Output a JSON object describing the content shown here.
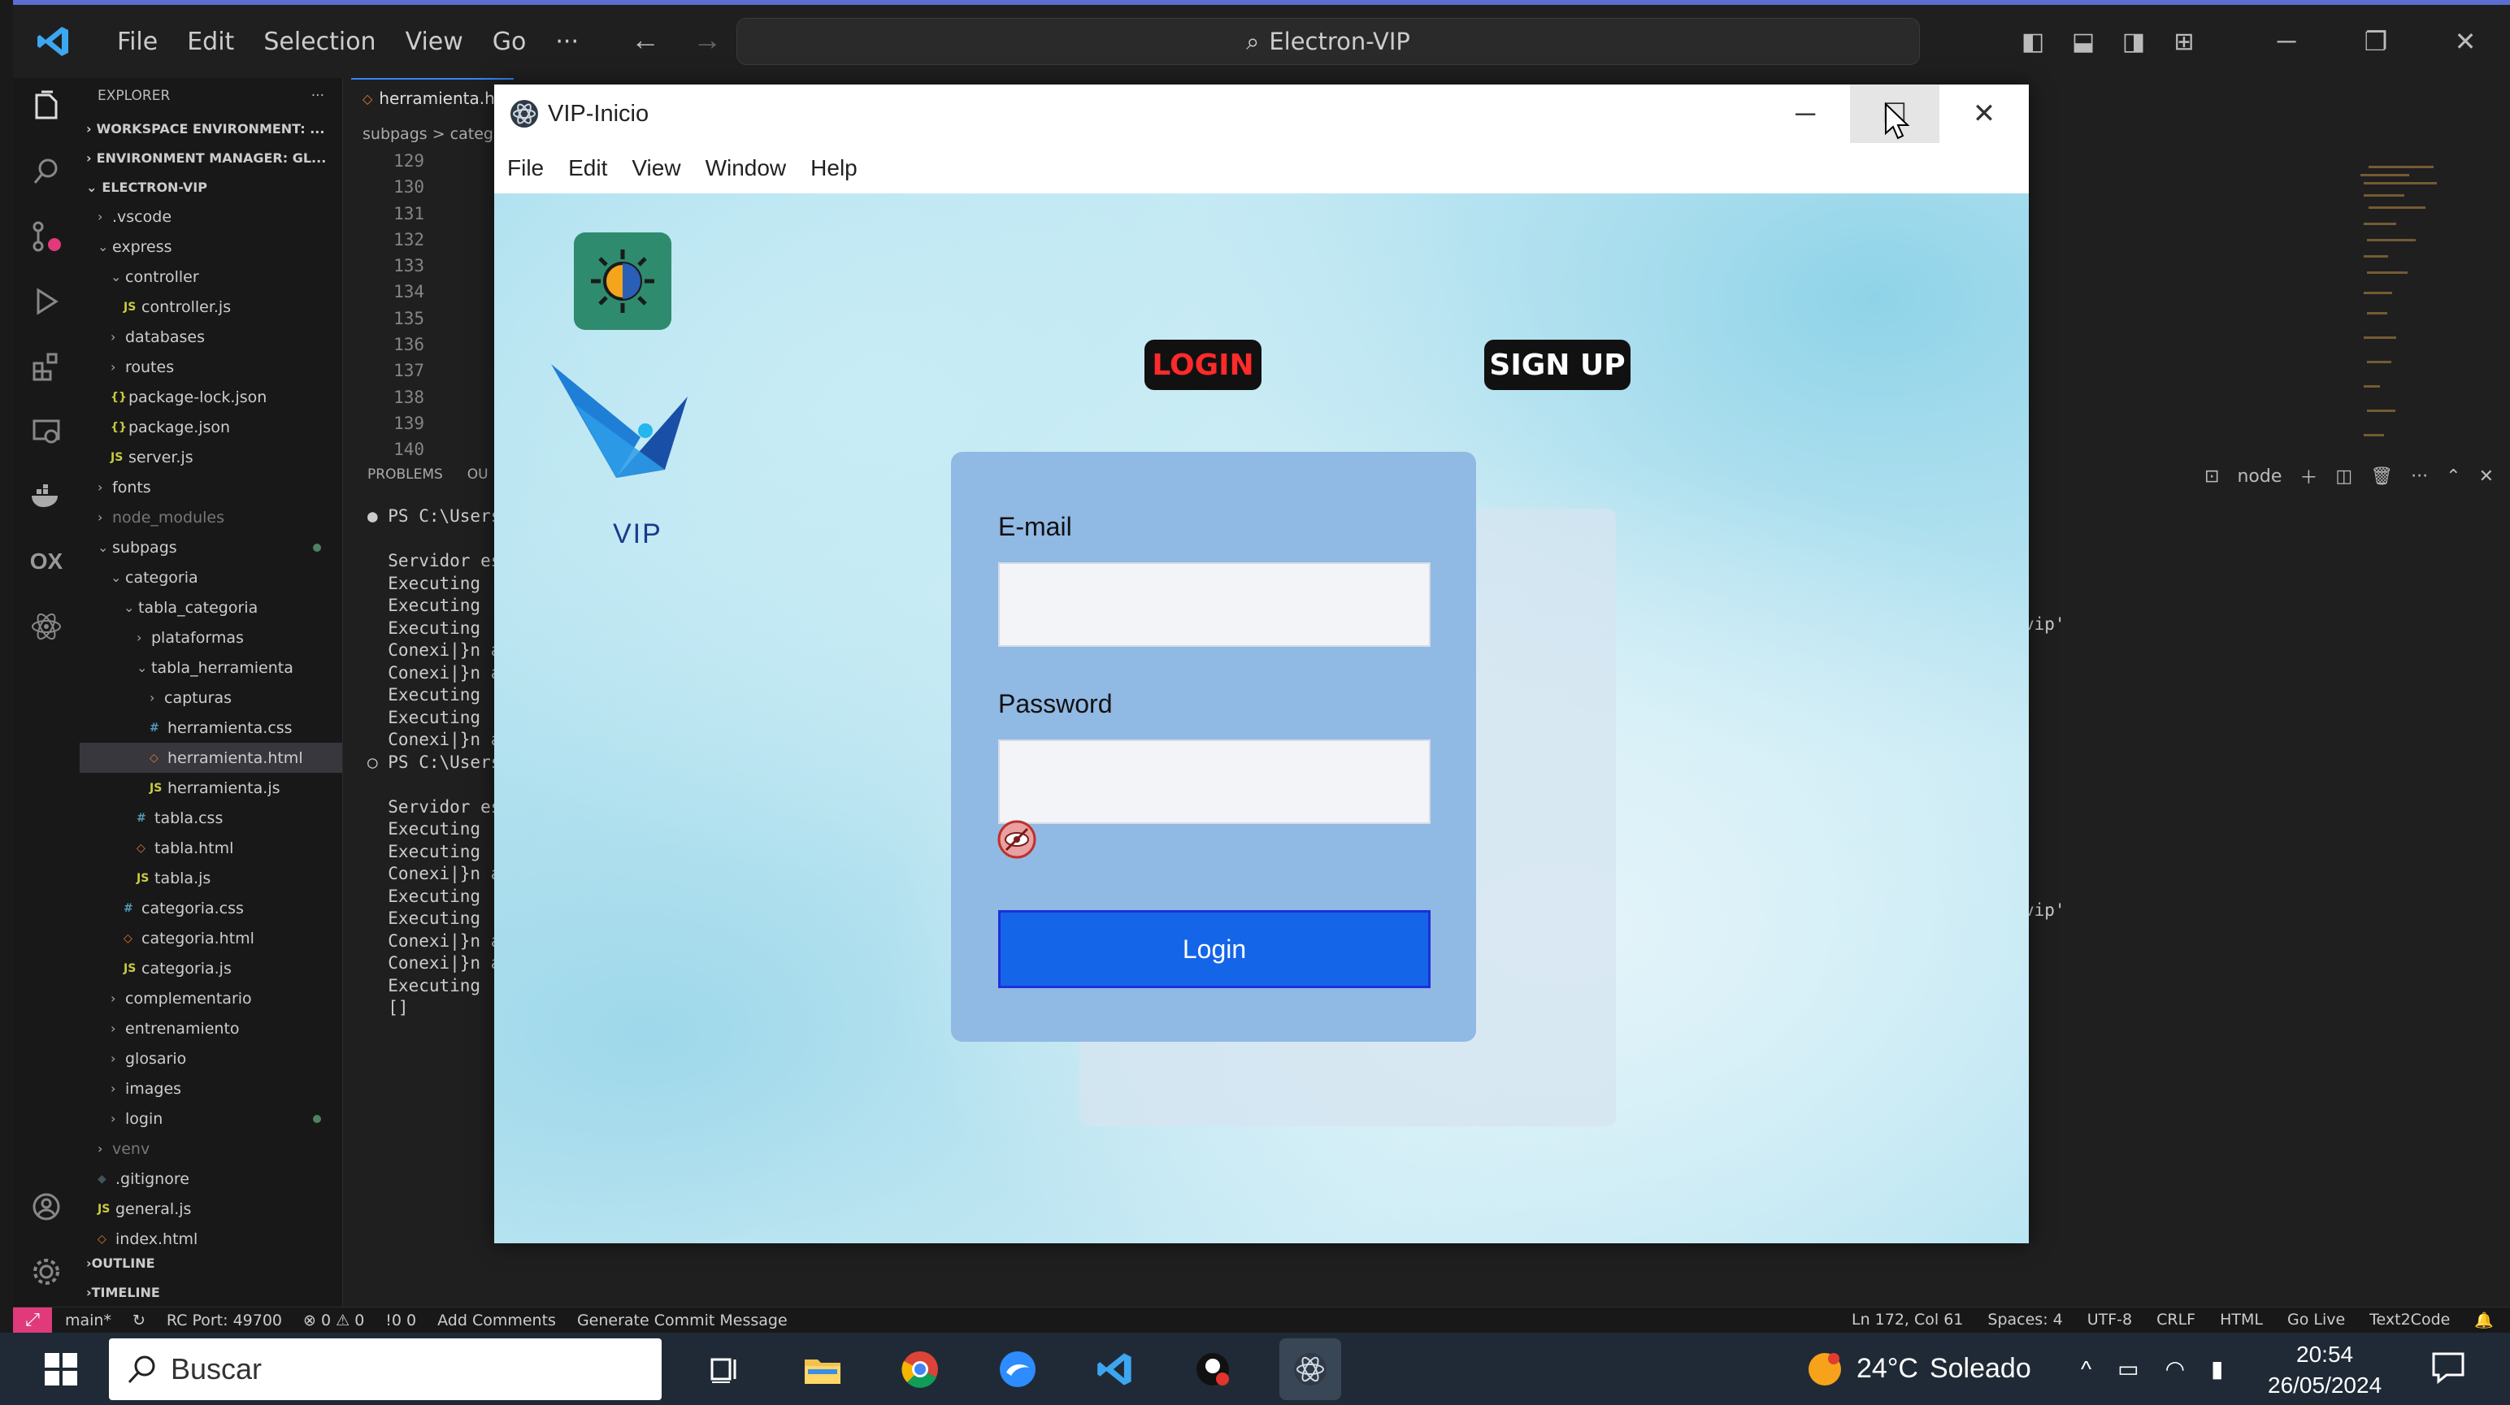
{
  "vscode": {
    "menu": [
      "File",
      "Edit",
      "Selection",
      "View",
      "Go",
      "···"
    ],
    "command_center": "Electron-VIP",
    "explorer": {
      "title": "EXPLORER",
      "sections": [
        "WORKSPACE ENVIRONMENT: ...",
        "ENVIRONMENT MANAGER: GL...",
        "ELECTRON-VIP"
      ],
      "tree": [
        {
          "label": ".vscode",
          "indent": 1,
          "type": "folder",
          "open": false
        },
        {
          "label": "express",
          "indent": 1,
          "type": "folder",
          "open": true
        },
        {
          "label": "controller",
          "indent": 2,
          "type": "folder",
          "open": true
        },
        {
          "label": "controller.js",
          "indent": 3,
          "type": "js"
        },
        {
          "label": "databases",
          "indent": 2,
          "type": "folder",
          "open": false
        },
        {
          "label": "routes",
          "indent": 2,
          "type": "folder",
          "open": false
        },
        {
          "label": "package-lock.json",
          "indent": 2,
          "type": "json"
        },
        {
          "label": "package.json",
          "indent": 2,
          "type": "json"
        },
        {
          "label": "server.js",
          "indent": 2,
          "type": "js"
        },
        {
          "label": "fonts",
          "indent": 1,
          "type": "folder",
          "open": false
        },
        {
          "label": "node_modules",
          "indent": 1,
          "type": "folder",
          "open": false,
          "dim": true
        },
        {
          "label": "subpags",
          "indent": 1,
          "type": "folder",
          "open": true,
          "dot": true
        },
        {
          "label": "categoria",
          "indent": 2,
          "type": "folder",
          "open": true
        },
        {
          "label": "tabla_categoria",
          "indent": 3,
          "type": "folder",
          "open": true
        },
        {
          "label": "plataformas",
          "indent": 4,
          "type": "folder",
          "open": false
        },
        {
          "label": "tabla_herramienta",
          "indent": 4,
          "type": "folder",
          "open": true
        },
        {
          "label": "capturas",
          "indent": 5,
          "type": "folder",
          "open": false
        },
        {
          "label": "herramienta.css",
          "indent": 5,
          "type": "css"
        },
        {
          "label": "herramienta.html",
          "indent": 5,
          "type": "html",
          "selected": true
        },
        {
          "label": "herramienta.js",
          "indent": 5,
          "type": "js"
        },
        {
          "label": "tabla.css",
          "indent": 4,
          "type": "css"
        },
        {
          "label": "tabla.html",
          "indent": 4,
          "type": "html"
        },
        {
          "label": "tabla.js",
          "indent": 4,
          "type": "js"
        },
        {
          "label": "categoria.css",
          "indent": 3,
          "type": "css"
        },
        {
          "label": "categoria.html",
          "indent": 3,
          "type": "html"
        },
        {
          "label": "categoria.js",
          "indent": 3,
          "type": "js"
        },
        {
          "label": "complementario",
          "indent": 2,
          "type": "folder",
          "open": false
        },
        {
          "label": "entrenamiento",
          "indent": 2,
          "type": "folder",
          "open": false
        },
        {
          "label": "glosario",
          "indent": 2,
          "type": "folder",
          "open": false
        },
        {
          "label": "images",
          "indent": 2,
          "type": "folder",
          "open": false
        },
        {
          "label": "login",
          "indent": 2,
          "type": "folder",
          "open": false,
          "dot": true
        },
        {
          "label": "venv",
          "indent": 1,
          "type": "folder",
          "open": false,
          "dim": true
        },
        {
          "label": ".gitignore",
          "indent": 1,
          "type": "git"
        },
        {
          "label": "general.js",
          "indent": 1,
          "type": "js"
        },
        {
          "label": "index.html",
          "indent": 1,
          "type": "html"
        }
      ],
      "bottom_sections": [
        "OUTLINE",
        "TIMELINE"
      ]
    },
    "tab_label": "herramienta.h",
    "breadcrumb": "subpags > categ",
    "line_numbers": [
      "129",
      "130",
      "131",
      "132",
      "133",
      "134",
      "135",
      "136",
      "137",
      "138",
      "139",
      "140"
    ],
    "panel_tabs": [
      "PROBLEMS",
      "OU"
    ],
    "terminal_lines": [
      "● PS C:\\Users\\",
      "",
      "  Servidor esc",
      "  Executing (d",
      "  Executing (d",
      "  Executing (d",
      "  Conexi|}n a",
      "  Conexi|}n a",
      "  Executing (d",
      "  Executing (d",
      "  Conexi|}n a",
      "○ PS C:\\Users\\",
      "",
      "  Servidor esc",
      "  Executing (d",
      "  Executing (d",
      "  Conexi|}n a",
      "  Executing (d",
      "  Executing (d",
      "  Conexi|}n a",
      "  Conexi|}n a",
      "  Executing (d",
      "  []"
    ],
    "terminal_fragments": [
      "vip'",
      "vip'"
    ],
    "terminal_name": "node",
    "status_left": [
      "main*",
      "↻",
      "RC Port: 49700",
      "⊗ 0 ⚠ 0",
      "!0 0",
      "Add Comments",
      "Generate Commit Message"
    ],
    "status_right": [
      "Ln 172, Col 61",
      "Spaces: 4",
      "UTF-8",
      "CRLF",
      "HTML",
      "Go Live",
      "Text2Code"
    ]
  },
  "taskbar": {
    "search_placeholder": "Buscar",
    "weather_temp": "24°C",
    "weather_text": "Soleado",
    "time": "20:54",
    "date": "26/05/2024"
  },
  "app": {
    "title": "VIP-Inicio",
    "menu": [
      "File",
      "Edit",
      "View",
      "Window",
      "Help"
    ],
    "nav_login": "LOGIN",
    "nav_signup": "SIGN UP",
    "logo_text": "VIP",
    "email_label": "E-mail",
    "email_value": "",
    "password_label": "Password",
    "password_value": "",
    "login_button": "Login",
    "colors": {
      "card": "#90b9e4",
      "button": "#1565e8",
      "nav_login_text": "#ff2a2a",
      "brightness_bg": "#2e8b6e"
    }
  }
}
